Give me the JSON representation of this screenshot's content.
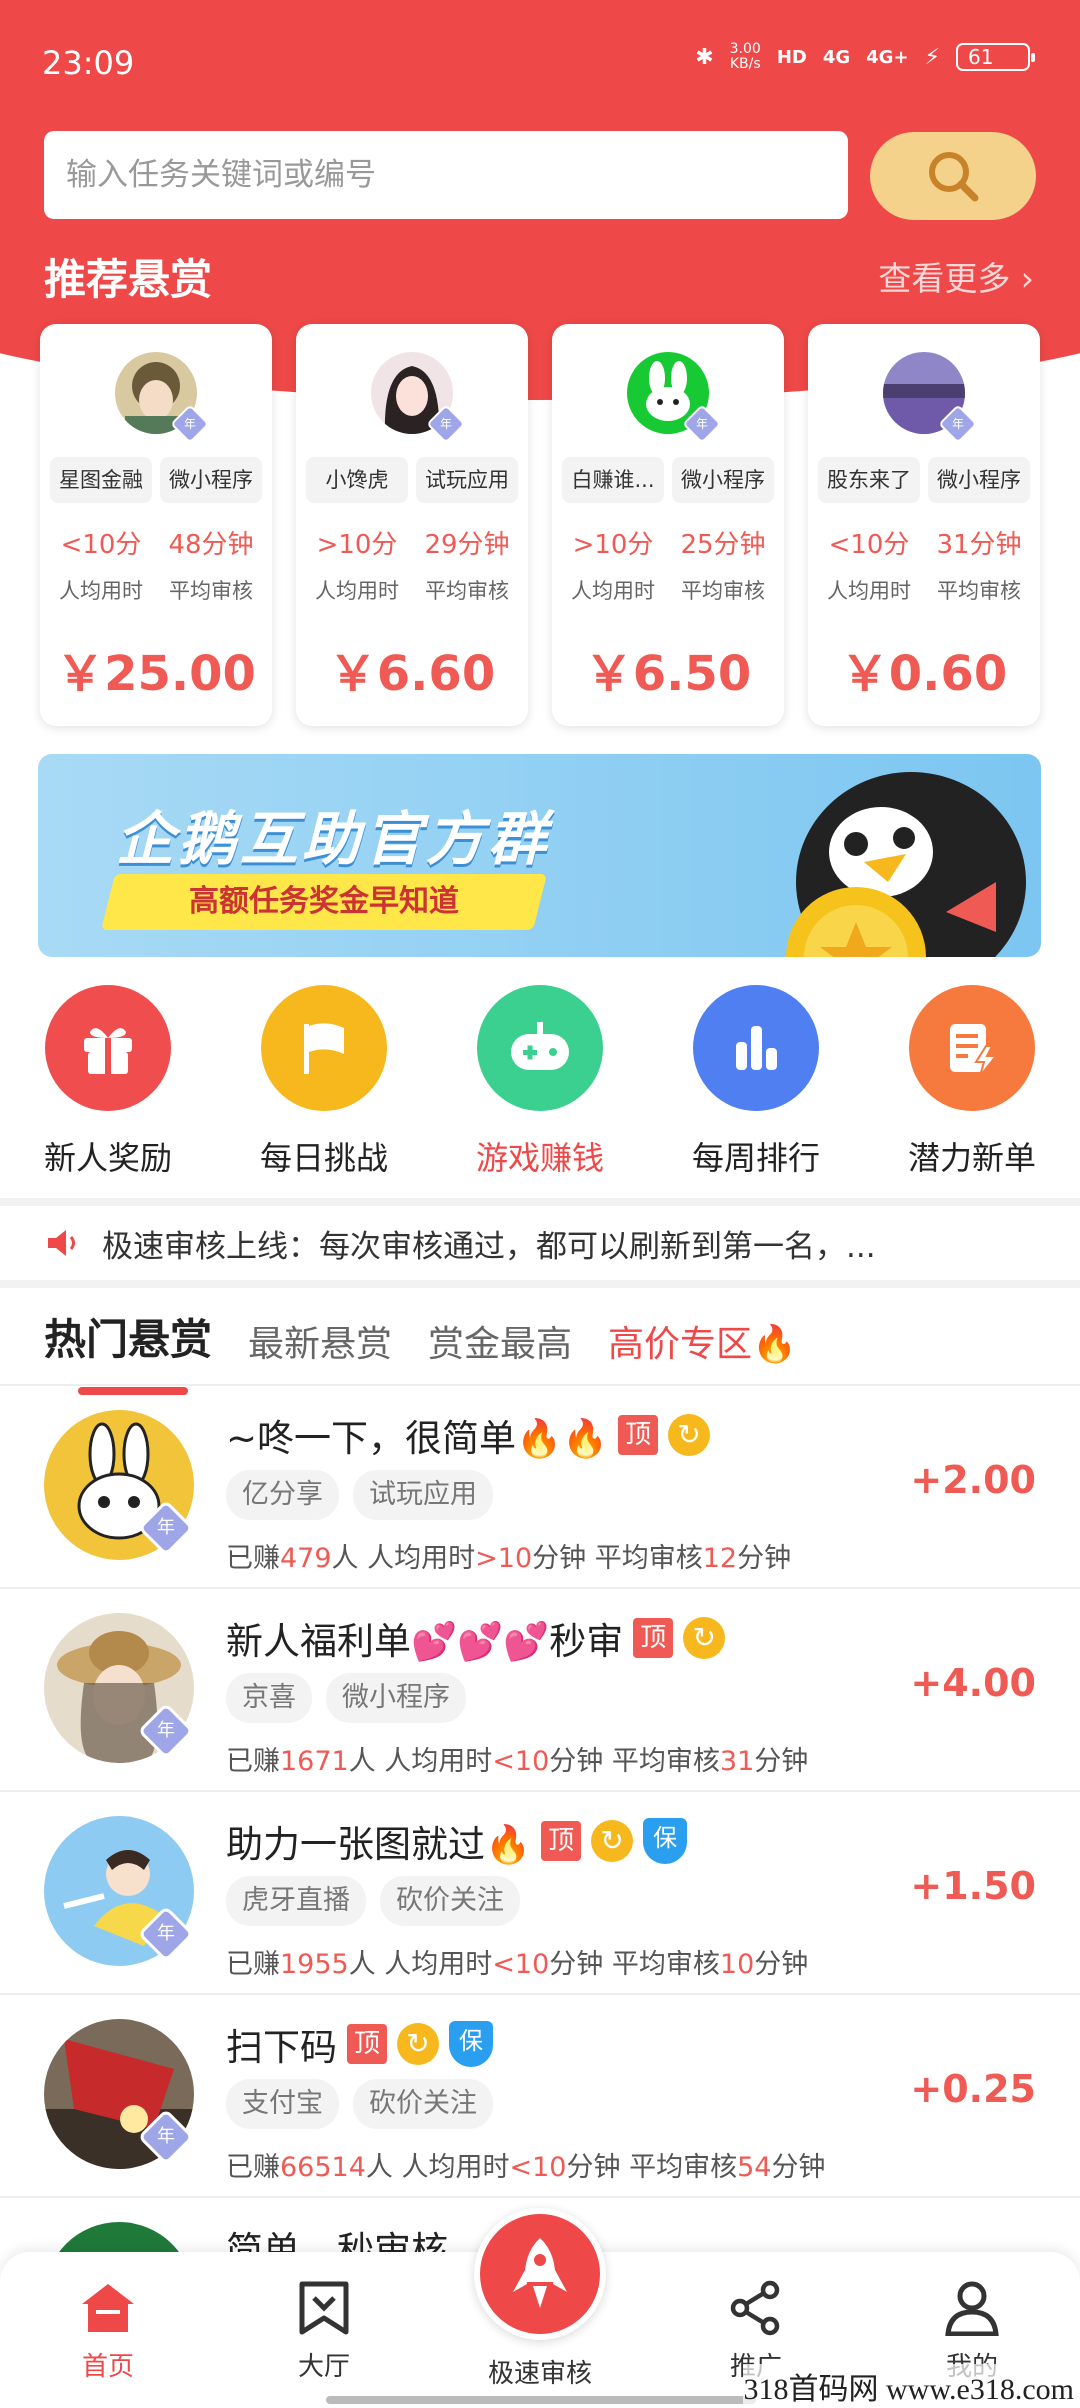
{
  "status": {
    "time": "23:09",
    "net_speed_top": "3.00",
    "net_speed_bottom": "KB/s",
    "hd": "HD",
    "signal1": "4G",
    "signal2": "4G+",
    "battery": "61"
  },
  "search": {
    "placeholder": "输入任务关键词或编号"
  },
  "recommend": {
    "title": "推荐悬赏",
    "more": "查看更多 ›",
    "cards": [
      {
        "tag1": "星图金融",
        "tag2": "微小程序",
        "time": "<10分",
        "audit": "48分钟",
        "time_label": "人均用时",
        "audit_label": "平均审核",
        "price": "￥25.00",
        "badge": "年"
      },
      {
        "tag1": "小馋虎",
        "tag2": "试玩应用",
        "time": ">10分",
        "audit": "29分钟",
        "time_label": "人均用时",
        "audit_label": "平均审核",
        "price": "￥6.60",
        "badge": "年"
      },
      {
        "tag1": "白赚谁...",
        "tag2": "微小程序",
        "time": ">10分",
        "audit": "25分钟",
        "time_label": "人均用时",
        "audit_label": "平均审核",
        "price": "￥6.50",
        "badge": "年"
      },
      {
        "tag1": "股东来了",
        "tag2": "微小程序",
        "time": "<10分",
        "audit": "31分钟",
        "time_label": "人均用时",
        "audit_label": "平均审核",
        "price": "￥0.60",
        "badge": "年"
      }
    ]
  },
  "banner": {
    "title": "企鹅互助官方群",
    "subtitle": "高额任务奖金早知道"
  },
  "quick": [
    {
      "label": "新人奖励",
      "color": "#f04e4e"
    },
    {
      "label": "每日挑战",
      "color": "#f6b81c"
    },
    {
      "label": "游戏赚钱",
      "color": "#3bd08f"
    },
    {
      "label": "每周排行",
      "color": "#4f7ff0"
    },
    {
      "label": "潜力新单",
      "color": "#f67a3e"
    }
  ],
  "notice": {
    "text": "极速审核上线：每次审核通过，都可以刷新到第一名，..."
  },
  "tabs": [
    "热门悬赏",
    "最新悬赏",
    "赏金最高",
    "高价专区🔥"
  ],
  "tasks": [
    {
      "title": "~咚一下，很简单🔥🔥",
      "tag1": "亿分享",
      "tag2": "试玩应用",
      "pre": "已赚",
      "count": "479",
      "mid1": "人 人均用时",
      "time": ">10",
      "mid2": "分钟 平均审核",
      "audit": "12",
      "post": "分钟",
      "amount": "+2.00",
      "ding": "顶",
      "badge": "年"
    },
    {
      "title": "新人福利单💕💕💕秒审",
      "tag1": "京喜",
      "tag2": "微小程序",
      "pre": "已赚",
      "count": "1671",
      "mid1": "人 人均用时",
      "time": "<10",
      "mid2": "分钟 平均审核",
      "audit": "31",
      "post": "分钟",
      "amount": "+4.00",
      "ding": "顶",
      "badge": "年"
    },
    {
      "title": "助力一张图就过🔥",
      "tag1": "虎牙直播",
      "tag2": "砍价关注",
      "pre": "已赚",
      "count": "1955",
      "mid1": "人 人均用时",
      "time": "<10",
      "mid2": "分钟 平均审核",
      "audit": "10",
      "post": "分钟",
      "amount": "+1.50",
      "ding": "顶",
      "bao": "保",
      "badge": "年"
    },
    {
      "title": "扫下码",
      "tag1": "支付宝",
      "tag2": "砍价关注",
      "pre": "已赚",
      "count": "66514",
      "mid1": "人 人均用时",
      "time": "<10",
      "mid2": "分钟 平均审核",
      "audit": "54",
      "post": "分钟",
      "amount": "+0.25",
      "ding": "顶",
      "bao": "保",
      "badge": "年"
    },
    {
      "title": "简单，秒审核"
    }
  ],
  "nav": {
    "home": "首页",
    "hall": "大厅",
    "fast": "极速审核",
    "promote": "推广",
    "mine": "我的"
  },
  "watermark": "318首码网 www.e318.com"
}
